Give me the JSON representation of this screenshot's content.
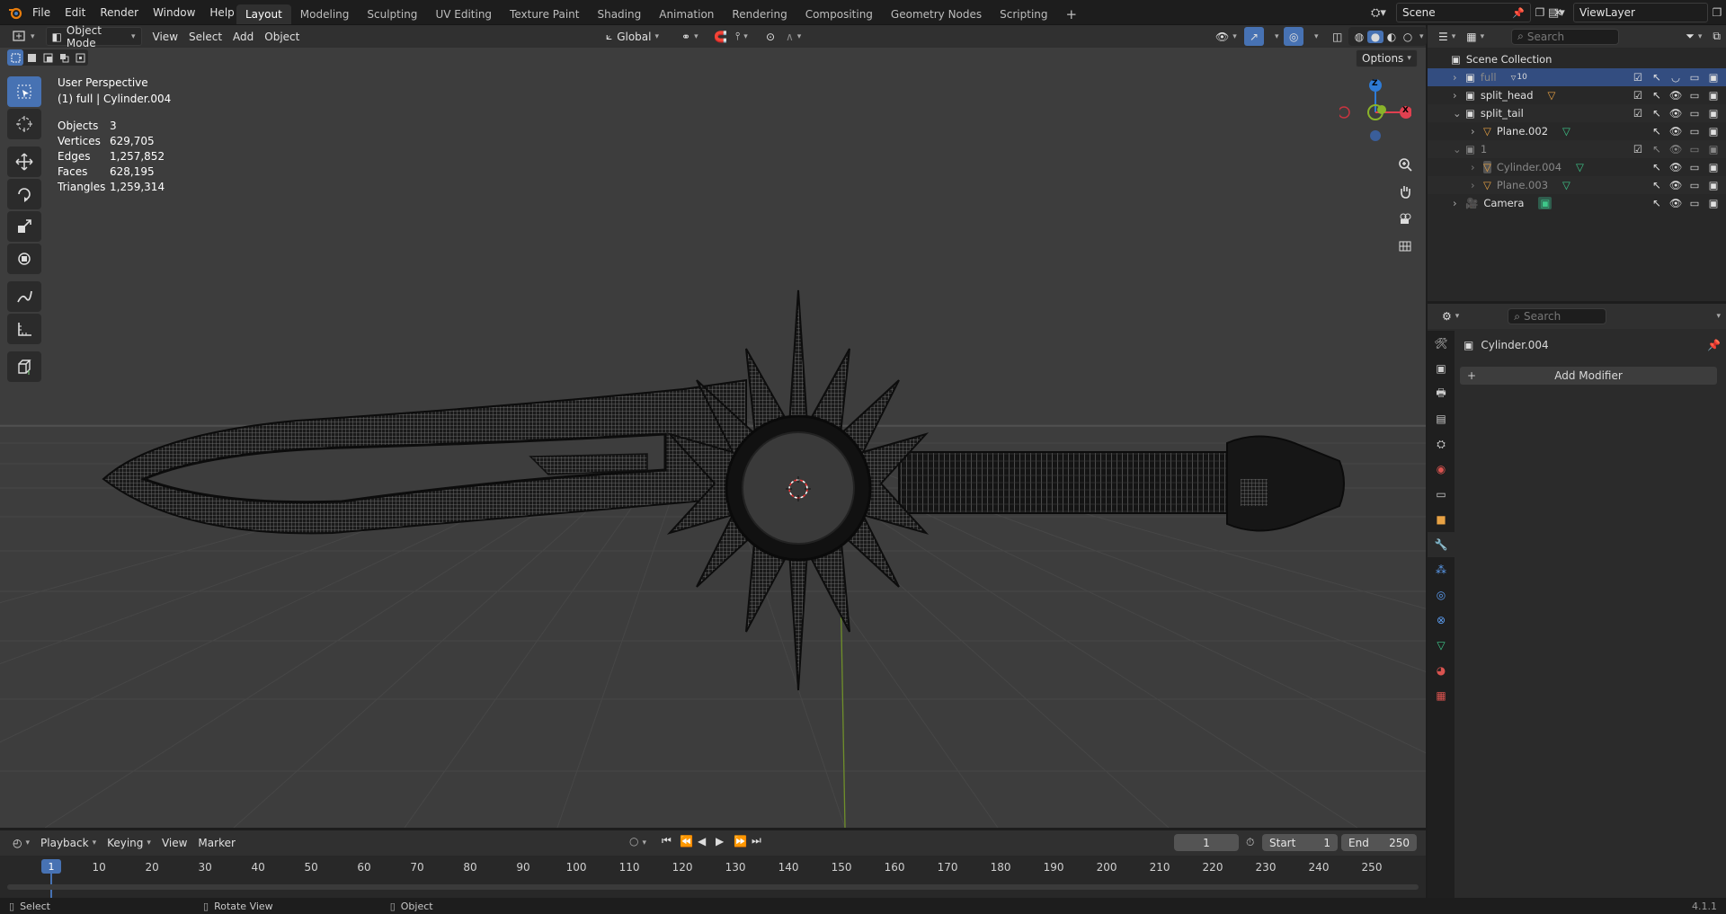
{
  "topbar": {
    "menus": [
      "File",
      "Edit",
      "Render",
      "Window",
      "Help"
    ],
    "workspaces": [
      "Layout",
      "Modeling",
      "Sculpting",
      "UV Editing",
      "Texture Paint",
      "Shading",
      "Animation",
      "Rendering",
      "Compositing",
      "Geometry Nodes",
      "Scripting"
    ],
    "active_workspace": "Layout",
    "scene_name": "Scene",
    "view_layer": "ViewLayer"
  },
  "viewport_header": {
    "mode": "Object Mode",
    "menus": [
      "View",
      "Select",
      "Add",
      "Object"
    ],
    "transform_orientation": "Global",
    "options_label": "Options"
  },
  "viewport": {
    "perspective": "User Perspective",
    "active_label": "(1) full | Cylinder.004",
    "stats": [
      {
        "label": "Objects",
        "value": "3"
      },
      {
        "label": "Vertices",
        "value": "629,705"
      },
      {
        "label": "Edges",
        "value": "1,257,852"
      },
      {
        "label": "Faces",
        "value": "628,195"
      },
      {
        "label": "Triangles",
        "value": "1,259,314"
      }
    ],
    "gizmo": {
      "z": "Z",
      "x": "X"
    }
  },
  "outliner": {
    "search_placeholder": "Search",
    "root": "Scene Collection",
    "rows": [
      {
        "name": "full",
        "badge": "10",
        "selected": true
      },
      {
        "name": "split_head"
      },
      {
        "name": "split_tail"
      },
      {
        "name": "Plane.002"
      },
      {
        "name": "1"
      },
      {
        "name": "Cylinder.004"
      },
      {
        "name": "Plane.003"
      },
      {
        "name": "Camera"
      }
    ]
  },
  "properties": {
    "search_placeholder": "Search",
    "object_name": "Cylinder.004",
    "add_modifier": "Add Modifier"
  },
  "timeline": {
    "menus": [
      "Playback",
      "Keying",
      "View",
      "Marker"
    ],
    "current_frame": "1",
    "start_label": "Start",
    "start": "1",
    "end_label": "End",
    "end": "250",
    "ticks": [
      "1",
      "10",
      "20",
      "30",
      "40",
      "50",
      "60",
      "70",
      "80",
      "90",
      "100",
      "110",
      "120",
      "130",
      "140",
      "150",
      "160",
      "170",
      "180",
      "190",
      "200",
      "210",
      "220",
      "230",
      "240",
      "250"
    ]
  },
  "statusbar": {
    "select": "Select",
    "rotate": "Rotate View",
    "object": "Object",
    "version": "4.1.1"
  }
}
